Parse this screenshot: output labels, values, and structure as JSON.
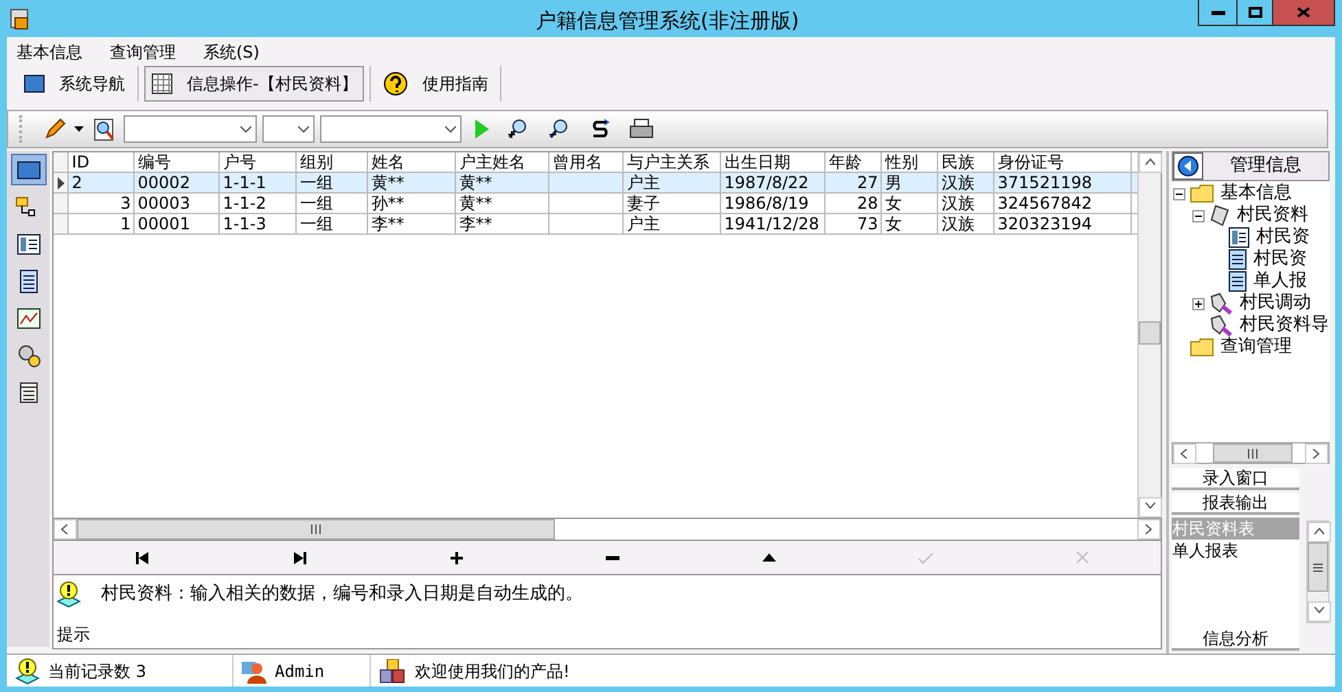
{
  "window": {
    "title": "户籍信息管理系统(非注册版)"
  },
  "menu": [
    "基本信息",
    "查询管理",
    "系统(S)"
  ],
  "tabs": [
    {
      "label": "系统导航",
      "selected": false
    },
    {
      "label": "信息操作-【村民资料】",
      "selected": true
    },
    {
      "label": "使用指南",
      "selected": false
    }
  ],
  "left_nav": [
    {
      "selected": true
    },
    {
      "selected": false
    },
    {
      "selected": false
    },
    {
      "selected": false
    },
    {
      "selected": false
    },
    {
      "selected": false
    },
    {
      "selected": false
    }
  ],
  "table": {
    "columns": [
      "ID",
      "编号",
      "户号",
      "组别",
      "姓名",
      "户主姓名",
      "曾用名",
      "与户主关系",
      "出生日期",
      "年龄",
      "性别",
      "民族",
      "身份证号"
    ],
    "rows": [
      {
        "selected": true,
        "cells": [
          "2",
          "00002",
          "1-1-1",
          "一组",
          "黄**",
          "黄**",
          "",
          "户主",
          "1987/8/22",
          "27",
          "男",
          "汉族",
          "371521198"
        ]
      },
      {
        "selected": false,
        "cells": [
          "3",
          "00003",
          "1-1-2",
          "一组",
          "孙**",
          "黄**",
          "",
          "妻子",
          "1986/8/19",
          "28",
          "女",
          "汉族",
          "324567842"
        ]
      },
      {
        "selected": false,
        "cells": [
          "1",
          "00001",
          "1-1-3",
          "一组",
          "李**",
          "李**",
          "",
          "户主",
          "1941/12/28",
          "73",
          "女",
          "汉族",
          "320323194"
        ]
      }
    ]
  },
  "navigator": [
    {
      "kind": "first",
      "disabled": false
    },
    {
      "kind": "last",
      "disabled": false
    },
    {
      "kind": "add",
      "disabled": false
    },
    {
      "kind": "delete",
      "disabled": false
    },
    {
      "kind": "edit",
      "disabled": false
    },
    {
      "kind": "post",
      "disabled": true
    },
    {
      "kind": "cancel",
      "disabled": true
    }
  ],
  "hint": {
    "text": "村民资料：输入相关的数据，编号和录入日期是自动生成的。",
    "label": "提示"
  },
  "side_panel": {
    "title": "管理信息",
    "tree": [
      {
        "label": "基本信息",
        "kind": "folder",
        "expanded": true,
        "children": [
          {
            "label": "村民资料",
            "kind": "module",
            "expanded": true,
            "children": [
              {
                "label": "村民资",
                "kind": "form"
              },
              {
                "label": "村民资",
                "kind": "report"
              },
              {
                "label": "单人报",
                "kind": "report"
              }
            ]
          },
          {
            "label": "村民调动",
            "kind": "tool",
            "expanded": false
          },
          {
            "label": "村民资料导",
            "kind": "tool"
          }
        ]
      },
      {
        "label": "查询管理",
        "kind": "folder"
      }
    ],
    "sections": [
      {
        "label": "录入窗口"
      },
      {
        "label": "报表输出",
        "items": [
          {
            "label": "村民资料表",
            "selected": true
          },
          {
            "label": "单人报表",
            "selected": false
          }
        ]
      },
      {
        "label": "信息分析"
      }
    ]
  },
  "status_bar": [
    "当前记录数 3",
    "Admin",
    "欢迎使用我们的产品!"
  ]
}
